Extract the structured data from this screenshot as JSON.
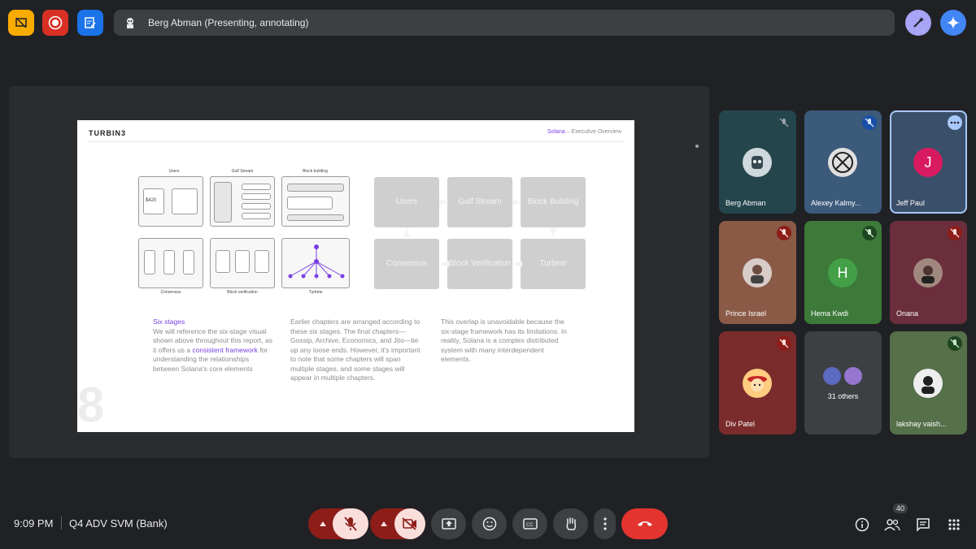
{
  "presenter_bar": {
    "label": "Berg Abman (Presenting, annotating)"
  },
  "slide": {
    "brand": "TURBIN3",
    "header_main": "Solana",
    "header_sub": " – Executive Overview",
    "diagram_labels": [
      "Users",
      "Gulf Stream",
      "Block building",
      "Consensus",
      "Block verification",
      "Turbine"
    ],
    "diagram_value": "$420",
    "flow_boxes": [
      "Users",
      "Gulf Stream",
      "Block Building",
      "Consensus",
      "Block Verification",
      "Turbine"
    ],
    "col1_head": "Six stages",
    "col1_text_a": "We will reference the six-stage visual shown above throughout this report, as it offers us a ",
    "col1_link": "consistent framework",
    "col1_text_b": " for understanding the relationships between Solana's core elements",
    "col2_text": "Earlier chapters are arranged according to these six stages. The final chapters—Gossip, Archive, Economics, and Jito—tie up any loose ends. However, it's important to note that some chapters will span multiple stages, and some stages will appear in multiple chapters.",
    "col3_text": "This overlap is unavoidable because the six-stage framework has its limitations. In reality, Solana is a complex distributed system with many interdependent elements.",
    "page_number": "8"
  },
  "participants": [
    {
      "name": "Berg Abman",
      "initial": "",
      "muted": true
    },
    {
      "name": "Alexey Kalmy...",
      "initial": "",
      "muted": true
    },
    {
      "name": "Jeff Paul",
      "initial": "J",
      "muted": false
    },
    {
      "name": "Prince Israel",
      "initial": "",
      "muted": true
    },
    {
      "name": "Hema Kwdi",
      "initial": "H",
      "muted": true
    },
    {
      "name": "Onana",
      "initial": "",
      "muted": true
    },
    {
      "name": "Div Patel",
      "initial": "",
      "muted": true
    },
    {
      "name": "31 others",
      "initial": "",
      "muted": false
    },
    {
      "name": "lakshay vaish...",
      "initial": "",
      "muted": true
    }
  ],
  "bottom": {
    "time": "9:09 PM",
    "meeting_name": "Q4 ADV SVM (Bank)",
    "people_count": "40"
  },
  "colors": {
    "accent_purple": "#7b3fe4",
    "end_call": "#e3342f",
    "tile_selected_border": "#a8c7fa"
  }
}
